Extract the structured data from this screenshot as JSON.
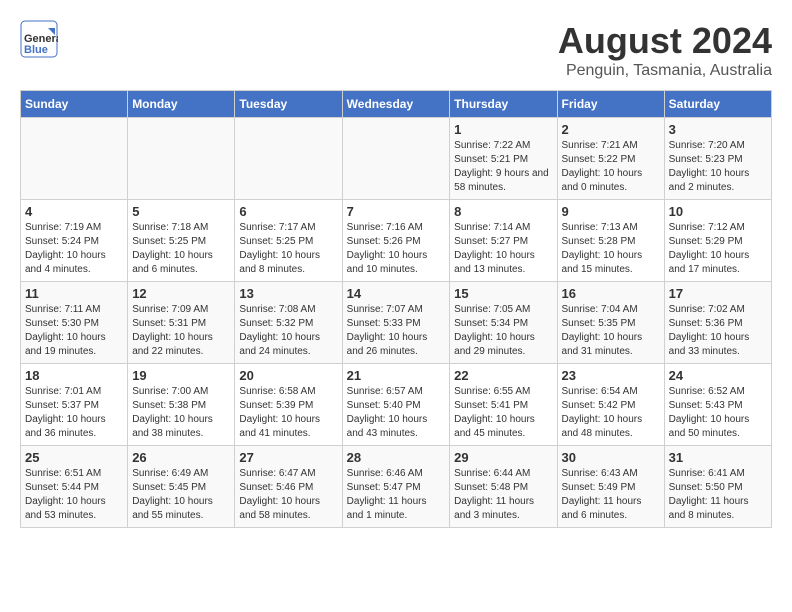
{
  "header": {
    "logo_general": "General",
    "logo_blue": "Blue",
    "month_year": "August 2024",
    "location": "Penguin, Tasmania, Australia"
  },
  "days_of_week": [
    "Sunday",
    "Monday",
    "Tuesday",
    "Wednesday",
    "Thursday",
    "Friday",
    "Saturday"
  ],
  "weeks": [
    [
      {
        "day": "",
        "info": ""
      },
      {
        "day": "",
        "info": ""
      },
      {
        "day": "",
        "info": ""
      },
      {
        "day": "",
        "info": ""
      },
      {
        "day": "1",
        "info": "Sunrise: 7:22 AM\nSunset: 5:21 PM\nDaylight: 9 hours and 58 minutes."
      },
      {
        "day": "2",
        "info": "Sunrise: 7:21 AM\nSunset: 5:22 PM\nDaylight: 10 hours and 0 minutes."
      },
      {
        "day": "3",
        "info": "Sunrise: 7:20 AM\nSunset: 5:23 PM\nDaylight: 10 hours and 2 minutes."
      }
    ],
    [
      {
        "day": "4",
        "info": "Sunrise: 7:19 AM\nSunset: 5:24 PM\nDaylight: 10 hours and 4 minutes."
      },
      {
        "day": "5",
        "info": "Sunrise: 7:18 AM\nSunset: 5:25 PM\nDaylight: 10 hours and 6 minutes."
      },
      {
        "day": "6",
        "info": "Sunrise: 7:17 AM\nSunset: 5:25 PM\nDaylight: 10 hours and 8 minutes."
      },
      {
        "day": "7",
        "info": "Sunrise: 7:16 AM\nSunset: 5:26 PM\nDaylight: 10 hours and 10 minutes."
      },
      {
        "day": "8",
        "info": "Sunrise: 7:14 AM\nSunset: 5:27 PM\nDaylight: 10 hours and 13 minutes."
      },
      {
        "day": "9",
        "info": "Sunrise: 7:13 AM\nSunset: 5:28 PM\nDaylight: 10 hours and 15 minutes."
      },
      {
        "day": "10",
        "info": "Sunrise: 7:12 AM\nSunset: 5:29 PM\nDaylight: 10 hours and 17 minutes."
      }
    ],
    [
      {
        "day": "11",
        "info": "Sunrise: 7:11 AM\nSunset: 5:30 PM\nDaylight: 10 hours and 19 minutes."
      },
      {
        "day": "12",
        "info": "Sunrise: 7:09 AM\nSunset: 5:31 PM\nDaylight: 10 hours and 22 minutes."
      },
      {
        "day": "13",
        "info": "Sunrise: 7:08 AM\nSunset: 5:32 PM\nDaylight: 10 hours and 24 minutes."
      },
      {
        "day": "14",
        "info": "Sunrise: 7:07 AM\nSunset: 5:33 PM\nDaylight: 10 hours and 26 minutes."
      },
      {
        "day": "15",
        "info": "Sunrise: 7:05 AM\nSunset: 5:34 PM\nDaylight: 10 hours and 29 minutes."
      },
      {
        "day": "16",
        "info": "Sunrise: 7:04 AM\nSunset: 5:35 PM\nDaylight: 10 hours and 31 minutes."
      },
      {
        "day": "17",
        "info": "Sunrise: 7:02 AM\nSunset: 5:36 PM\nDaylight: 10 hours and 33 minutes."
      }
    ],
    [
      {
        "day": "18",
        "info": "Sunrise: 7:01 AM\nSunset: 5:37 PM\nDaylight: 10 hours and 36 minutes."
      },
      {
        "day": "19",
        "info": "Sunrise: 7:00 AM\nSunset: 5:38 PM\nDaylight: 10 hours and 38 minutes."
      },
      {
        "day": "20",
        "info": "Sunrise: 6:58 AM\nSunset: 5:39 PM\nDaylight: 10 hours and 41 minutes."
      },
      {
        "day": "21",
        "info": "Sunrise: 6:57 AM\nSunset: 5:40 PM\nDaylight: 10 hours and 43 minutes."
      },
      {
        "day": "22",
        "info": "Sunrise: 6:55 AM\nSunset: 5:41 PM\nDaylight: 10 hours and 45 minutes."
      },
      {
        "day": "23",
        "info": "Sunrise: 6:54 AM\nSunset: 5:42 PM\nDaylight: 10 hours and 48 minutes."
      },
      {
        "day": "24",
        "info": "Sunrise: 6:52 AM\nSunset: 5:43 PM\nDaylight: 10 hours and 50 minutes."
      }
    ],
    [
      {
        "day": "25",
        "info": "Sunrise: 6:51 AM\nSunset: 5:44 PM\nDaylight: 10 hours and 53 minutes."
      },
      {
        "day": "26",
        "info": "Sunrise: 6:49 AM\nSunset: 5:45 PM\nDaylight: 10 hours and 55 minutes."
      },
      {
        "day": "27",
        "info": "Sunrise: 6:47 AM\nSunset: 5:46 PM\nDaylight: 10 hours and 58 minutes."
      },
      {
        "day": "28",
        "info": "Sunrise: 6:46 AM\nSunset: 5:47 PM\nDaylight: 11 hours and 1 minute."
      },
      {
        "day": "29",
        "info": "Sunrise: 6:44 AM\nSunset: 5:48 PM\nDaylight: 11 hours and 3 minutes."
      },
      {
        "day": "30",
        "info": "Sunrise: 6:43 AM\nSunset: 5:49 PM\nDaylight: 11 hours and 6 minutes."
      },
      {
        "day": "31",
        "info": "Sunrise: 6:41 AM\nSunset: 5:50 PM\nDaylight: 11 hours and 8 minutes."
      }
    ]
  ]
}
